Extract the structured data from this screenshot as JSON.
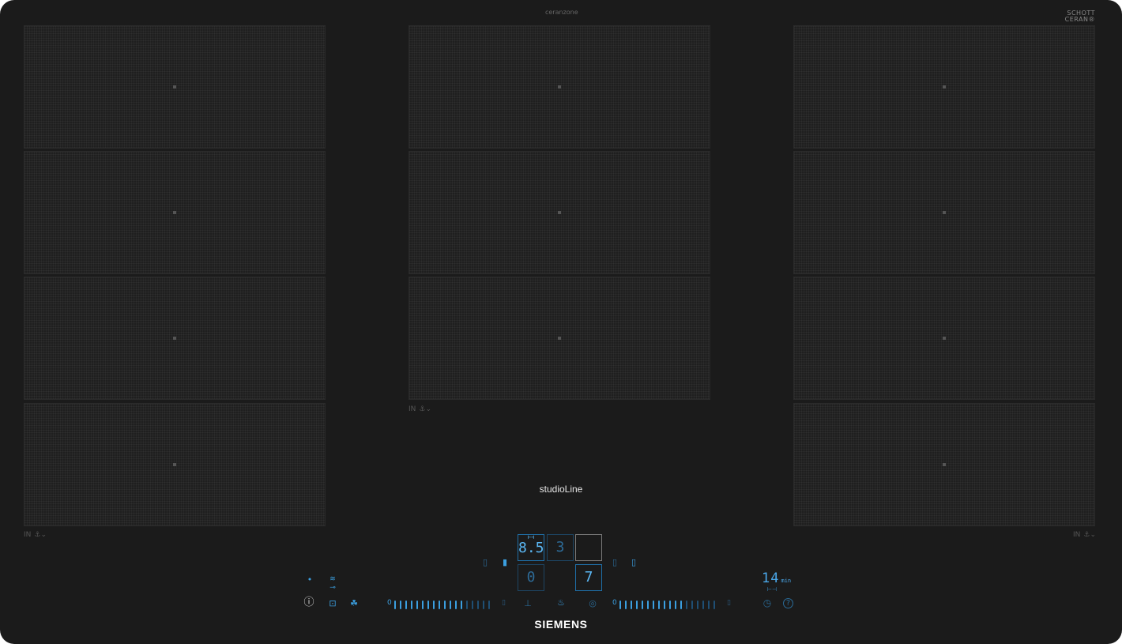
{
  "header": {
    "center_text": "ceranzone"
  },
  "schott": {
    "line1": "SCHOTT",
    "line2": "CERAN®"
  },
  "cooktop": {
    "series": "studioLine",
    "brand": "SIEMENS"
  },
  "zone_labels": {
    "in": "IN",
    "pot": "⚓︎⌄"
  },
  "control": {
    "display_level": "8.5",
    "display_level_icon": "⊢⊣",
    "display_power": "3",
    "display_power_empty": "",
    "display_low_empty": "0",
    "display_value": "7",
    "icons": {
      "dot": "•",
      "wifi": "≋",
      "key": "⊸",
      "power": "ⓘ",
      "hood_link": "⊡",
      "fan": "☘",
      "pan_left": "▯",
      "pan_mid": "▮",
      "pan_right": "▯",
      "pan_far": "▯",
      "pot_small": "⊥",
      "boost": "♨",
      "camera": "◎",
      "clock": "◷",
      "question": "?"
    },
    "slider_left": {
      "start": "0",
      "end": "▯",
      "level": 0.72
    },
    "slider_right": {
      "start": "0",
      "end": "▯",
      "level": 0.68
    },
    "timer": {
      "value": "14",
      "unit": "min",
      "icon": "⊢⊣"
    }
  }
}
